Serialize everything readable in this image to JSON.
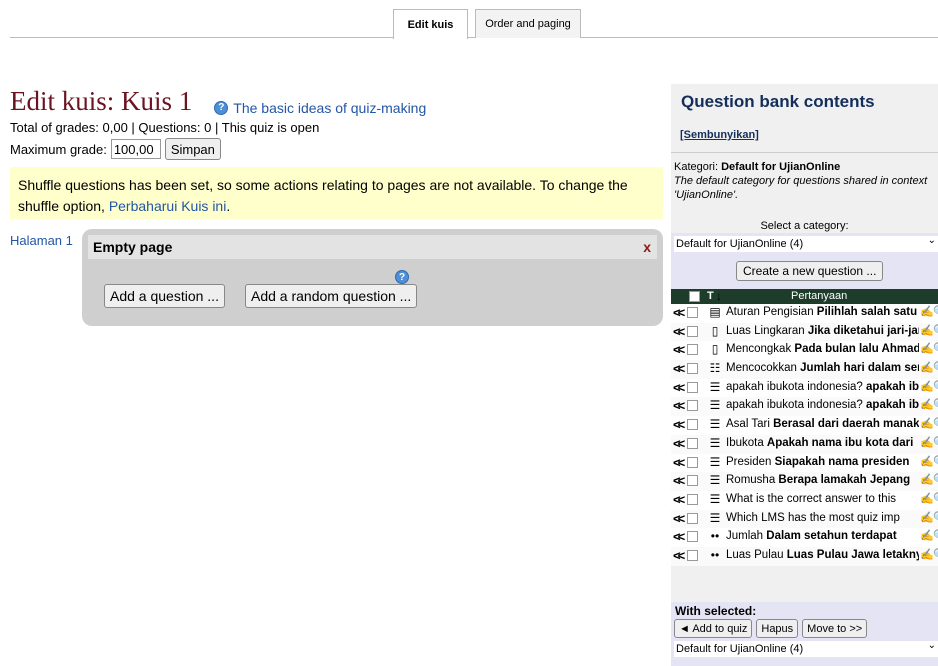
{
  "tabs": [
    {
      "label": "Edit kuis",
      "active": true
    },
    {
      "label": "Order and paging",
      "active": false
    }
  ],
  "main": {
    "title": "Edit kuis: Kuis 1",
    "help_link": "The basic ideas of quiz-making",
    "info": "Total of grades: 0,00 | Questions: 0 | This quiz is open",
    "max_grade_label": "Maximum grade:",
    "max_grade_value": "100,00",
    "save_label": "Simpan",
    "notice_text": "Shuffle questions has been set, so some actions relating to pages are not available. To change the shuffle option, ",
    "notice_link": "Perbaharui Kuis ini",
    "notice_end": ".",
    "page_label": "Halaman 1",
    "empty_page": "Empty page",
    "delete_symbol": "x",
    "add_question": "Add a question ...",
    "add_random": "Add a random question ...",
    "help_glyph": "?"
  },
  "bank": {
    "title": "Question bank contents",
    "hide_link": "[Sembunyikan]",
    "category_prefix": "Kategori: ",
    "category_name": "Default for UjianOnline",
    "category_desc": "The default category for questions shared in context 'UjianOnline'.",
    "select_label": "Select a category:",
    "category_selected": "Default for UjianOnline (4)",
    "create_button": "Create a new question ...",
    "column_type": "T",
    "column_sort_arrow": "↓",
    "column_name": "Pertanyaan",
    "questions": [
      {
        "icon": "essay-icon",
        "glyph": "▤",
        "name": "Aturan Pengisian ",
        "text": "Pilihlah salah satu jawaban yang benar"
      },
      {
        "icon": "shortanswer-icon",
        "glyph": "▯",
        "name": "Luas Lingkaran ",
        "text": "Jika diketahui jari-jari lingkaran"
      },
      {
        "icon": "shortanswer-icon",
        "glyph": "▯",
        "name": "Mencongkak ",
        "text": "Pada bulan lalu Ahmad"
      },
      {
        "icon": "matching-icon",
        "glyph": "☷",
        "name": "Mencocokkan ",
        "text": "Jumlah hari dalam seminggu"
      },
      {
        "icon": "multichoice-icon",
        "glyph": "☰",
        "name": "apakah ibukota indonesia? ",
        "text": "apakah ibukota"
      },
      {
        "icon": "multichoice-icon",
        "glyph": "☰",
        "name": "apakah ibukota indonesia? ",
        "text": "apakah ibukota"
      },
      {
        "icon": "multichoice-icon",
        "glyph": "☰",
        "name": "Asal Tari ",
        "text": "Berasal dari daerah manakah"
      },
      {
        "icon": "multichoice-icon",
        "glyph": "☰",
        "name": "Ibukota ",
        "text": "Apakah nama ibu kota dari"
      },
      {
        "icon": "multichoice-icon",
        "glyph": "☰",
        "name": "Presiden ",
        "text": "Siapakah nama presiden"
      },
      {
        "icon": "multichoice-icon",
        "glyph": "☰",
        "name": "Romusha ",
        "text": "Berapa lamakah Jepang"
      },
      {
        "icon": "multichoice-icon",
        "glyph": "☰",
        "name": "What is the correct answer to this",
        "text": ""
      },
      {
        "icon": "multichoice-icon",
        "glyph": "☰",
        "name": "Which LMS has the most quiz imp",
        "text": ""
      },
      {
        "icon": "truefalse-icon",
        "glyph": "••",
        "name": "Jumlah ",
        "text": "Dalam setahun terdapat"
      },
      {
        "icon": "truefalse-icon",
        "glyph": "••",
        "name": "Luas Pulau ",
        "text": "Luas Pulau Jawa letaknya"
      }
    ],
    "move_glyph": "<<",
    "edit_glyph": "✍",
    "preview_glyph": "🔍",
    "with_selected": "With selected:",
    "add_to_quiz": "◄ Add to quiz",
    "delete_label": "Hapus",
    "move_to": "Move to >>",
    "move_selected": "Default for UjianOnline (4)"
  }
}
